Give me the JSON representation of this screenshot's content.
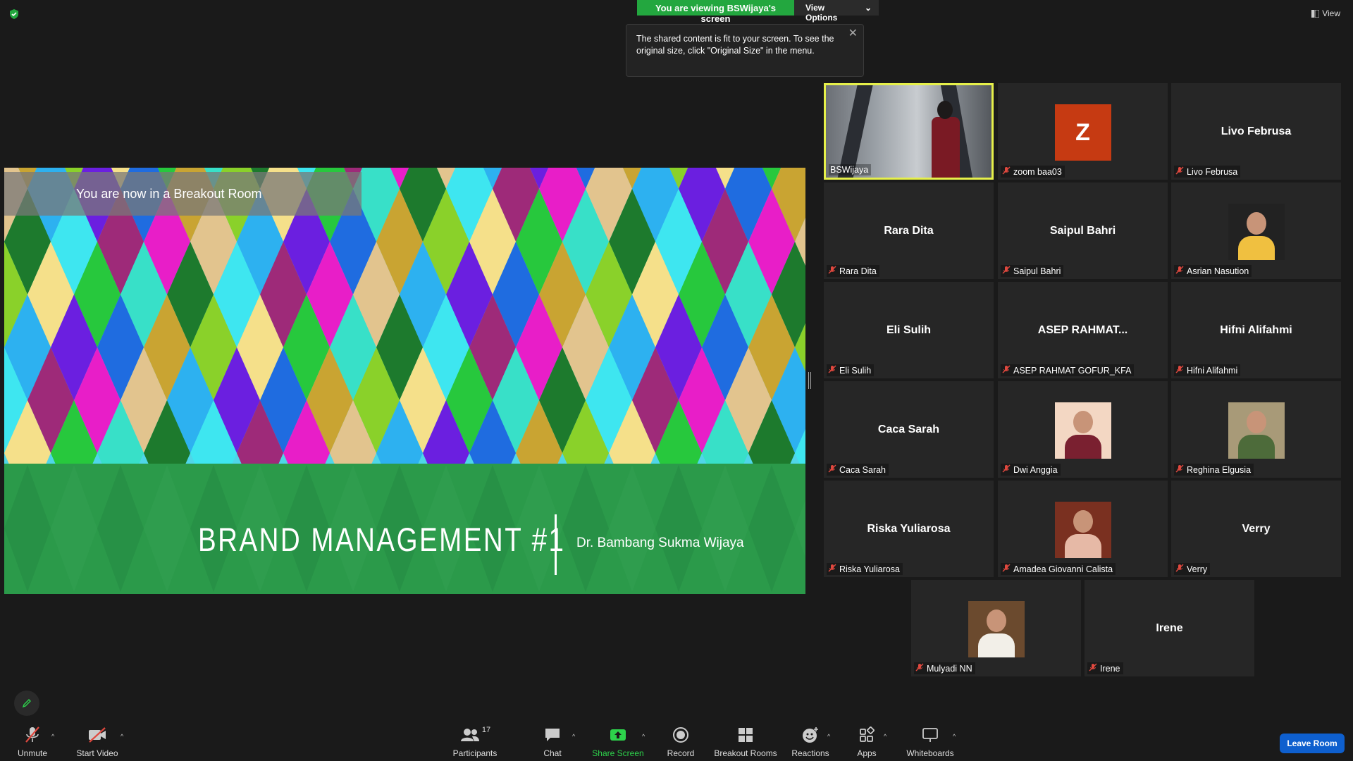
{
  "top": {
    "viewing_text": "You are viewing BSWijaya's screen",
    "view_options_label": "View Options",
    "tooltip_text": "The shared content is fit to your screen. To see the original size, click \"Original Size\" in the menu.",
    "view_label": "View"
  },
  "shared": {
    "banner": "You are now in a Breakout Room",
    "slide_title": "BRAND MANAGEMENT #1",
    "slide_author": "Dr. Bambang Sukma Wijaya"
  },
  "gallery": [
    {
      "name": "BSWijaya",
      "big": "",
      "kind": "video"
    },
    {
      "name": "zoom baa03",
      "big": "",
      "kind": "letter",
      "letter": "Z"
    },
    {
      "name": "Livo Februsa",
      "big": "Livo Februsa",
      "kind": "text"
    },
    {
      "name": "Rara Dita",
      "big": "Rara Dita",
      "kind": "text"
    },
    {
      "name": "Saipul Bahri",
      "big": "Saipul Bahri",
      "kind": "text"
    },
    {
      "name": "Asrian Nasution",
      "big": "",
      "kind": "photo"
    },
    {
      "name": "Eli Sulih",
      "big": "Eli Sulih",
      "kind": "text"
    },
    {
      "name": "ASEP RAHMAT GOFUR_KFA",
      "big": "ASEP  RAHMAT...",
      "kind": "text"
    },
    {
      "name": "Hifni Alifahmi",
      "big": "Hifni Alifahmi",
      "kind": "text"
    },
    {
      "name": "Caca Sarah",
      "big": "Caca Sarah",
      "kind": "text"
    },
    {
      "name": "Dwi Anggia",
      "big": "",
      "kind": "photo"
    },
    {
      "name": "Reghina Elgusia",
      "big": "",
      "kind": "photo"
    },
    {
      "name": "Riska Yuliarosa",
      "big": "Riska Yuliarosa",
      "kind": "text"
    },
    {
      "name": "Amadea Giovanni Calista",
      "big": "",
      "kind": "photo"
    },
    {
      "name": "Verry",
      "big": "Verry",
      "kind": "text"
    },
    {
      "name": "Mulyadi NN",
      "big": "",
      "kind": "photo"
    },
    {
      "name": "Irene",
      "big": "Irene",
      "kind": "text"
    }
  ],
  "toolbar": {
    "unmute": "Unmute",
    "start_video": "Start Video",
    "participants": "Participants",
    "participants_count": "17",
    "chat": "Chat",
    "share_screen": "Share Screen",
    "record": "Record",
    "breakout_rooms": "Breakout Rooms",
    "reactions": "Reactions",
    "apps": "Apps",
    "whiteboards": "Whiteboards",
    "leave_room": "Leave Room"
  },
  "colors": {
    "accent_green": "#23a73f",
    "leave_blue": "#0e5fce",
    "active_border": "#e6f04a",
    "muted_red": "#e0483e"
  }
}
